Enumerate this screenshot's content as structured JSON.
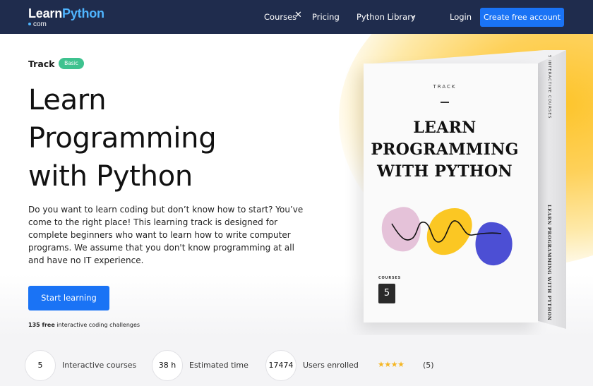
{
  "nav": {
    "logo_learn": "Learn",
    "logo_python": "Python",
    "logo_sub": "com",
    "items": [
      "Courses",
      "Pricing",
      "Python Library"
    ],
    "close_glyph": "✕",
    "login": "Login",
    "create_account": "Create free account"
  },
  "hero": {
    "track_label": "Track",
    "badge": "Basic",
    "title_lines": [
      "Learn",
      "Programming",
      "with Python"
    ],
    "description": "Do you want to learn coding but don’t know how to start? You’ve come to the right place! This learning track is designed for complete beginners who want to learn how to write computer programs. We assume that you don't know programming at all and have no IT experience.",
    "start_button": "Start learning",
    "challenges_count": "135 free",
    "challenges_text": " interactive coding challenges"
  },
  "box": {
    "track": "TRACK",
    "title_lines": [
      "LEARN",
      "PROGRAMMING",
      "WITH PYTHON"
    ],
    "courses_label": "COURSES",
    "courses_count": "5",
    "side_top_text": "5 INTERACTIVE COURSES",
    "side_title": "LEARN PROGRAMMING WITH PYTHON"
  },
  "stats": [
    {
      "value": "5",
      "label": "Interactive courses"
    },
    {
      "value": "38 h",
      "label": "Estimated time"
    },
    {
      "value": "17474",
      "label": "Users enrolled"
    }
  ],
  "rating": {
    "stars": 4,
    "stars_glyphs": "★★★★",
    "count": "(5)"
  },
  "colors": {
    "nav_bg": "#1f2c4d",
    "accent_blue": "#1a73f5",
    "logo_blue": "#4fb5ff",
    "badge_green": "#3ec28f",
    "star_gold": "#f5b623",
    "glow_yellow": "#fdc42a",
    "art_pink": "#e5c2d9",
    "art_yellow": "#fbc723",
    "art_blue": "#4c4fd4"
  }
}
